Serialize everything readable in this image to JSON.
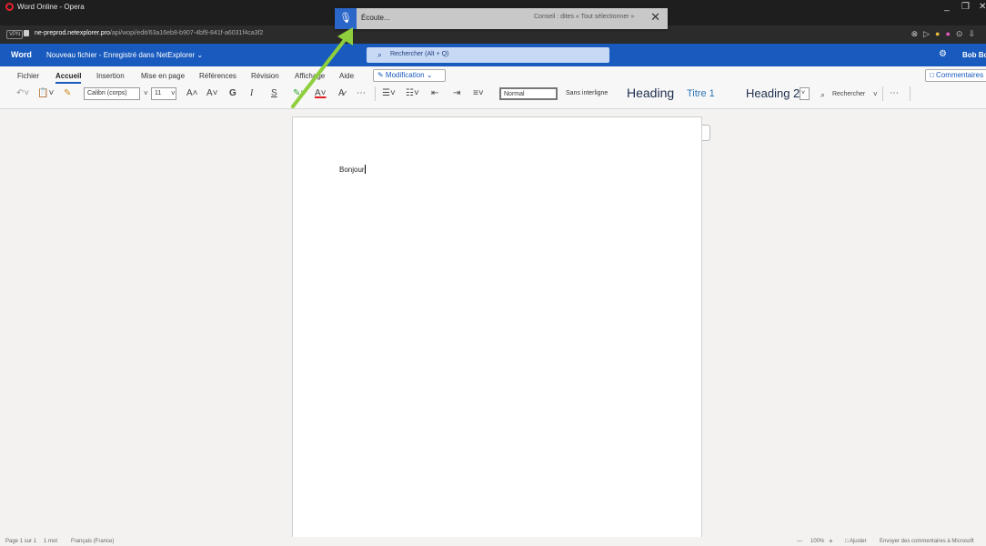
{
  "browser": {
    "window_title": "Word Online - Opera",
    "vpn_label": "VPN",
    "url_host": "ne-preprod.netexplorer.pro",
    "url_path": "/api/wopi/edit/63a16eb8-b907-4bf9-841f-a6031f4ca3f2",
    "minimize_glyph": "_",
    "restore_glyph": "❐",
    "close_glyph": "✕"
  },
  "dictation": {
    "status": "Écoute...",
    "tip": "Conseil : dites « Tout sélectionner »",
    "close_glyph": "✕"
  },
  "word": {
    "app_name": "Word",
    "doc_title": "Nouveau fichier - Enregistré dans NetExplorer ⌄",
    "search_placeholder": "Rechercher (Alt + Q)",
    "user": "Bob Bo"
  },
  "ribbon": {
    "tabs": [
      "Fichier",
      "Accueil",
      "Insertion",
      "Mise en page",
      "Références",
      "Révision",
      "Affichage",
      "Aide"
    ],
    "active_tab": "Accueil",
    "mode_button": "✎ Modification ⌄",
    "comments_button": "□ Commentaires",
    "font_name": "Calibri (corps)",
    "font_size": "11",
    "search_tool": "Rechercher",
    "styles": {
      "normal": "Normal",
      "no_spacing": "Sans interligne",
      "heading": "Heading",
      "title1": "Titre 1",
      "heading2": "Heading 2"
    }
  },
  "document": {
    "text": "Bonjour"
  },
  "statusbar": {
    "page": "Page 1 sur 1",
    "words": "1 mot",
    "language": "Français (France)",
    "zoom_minus": "—",
    "zoom": "100%",
    "zoom_plus": "+",
    "fit": "□ Ajuster",
    "feedback": "Envoyer des commentaires à Microsoft"
  },
  "colors": {
    "word_blue": "#185abd",
    "dictation_blue": "#2b66c9",
    "arrow_green": "#8fce3c"
  }
}
